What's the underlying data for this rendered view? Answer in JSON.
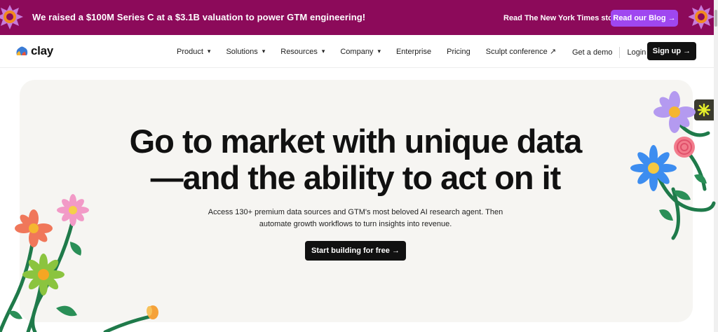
{
  "banner": {
    "announcement": "We raised a $100M Series C at a $3.1B valuation to power GTM engineering!",
    "nyt_link": "Read The New York Times story ↗",
    "blog_button": "Read our Blog →"
  },
  "nav": {
    "logo": "clay",
    "menu": [
      {
        "label": "Product",
        "chevron": "▾"
      },
      {
        "label": "Solutions",
        "chevron": "▾"
      },
      {
        "label": "Resources",
        "chevron": "▾"
      },
      {
        "label": "Company",
        "chevron": "▾"
      },
      {
        "label": "Enterprise",
        "chevron": ""
      },
      {
        "label": "Pricing",
        "chevron": ""
      },
      {
        "label": "Sculpt conference ↗",
        "chevron": ""
      }
    ],
    "get_demo": "Get a demo",
    "login": "Login",
    "signup": "Sign up →"
  },
  "hero": {
    "headline_line1": "Go to market with unique data",
    "headline_line2": "—and the ability to act on it",
    "subtext_line1": "Access 130+ premium data sources and GTM's most beloved AI research agent. Then",
    "subtext_line2": "automate growth workflows to turn insights into revenue.",
    "cta": "Start building for free →"
  },
  "colors": {
    "banner_bg": "#8c0a5a",
    "blog_button": "#9f47f0",
    "hero_bg": "#f6f5f2",
    "dark_button": "#111111"
  }
}
